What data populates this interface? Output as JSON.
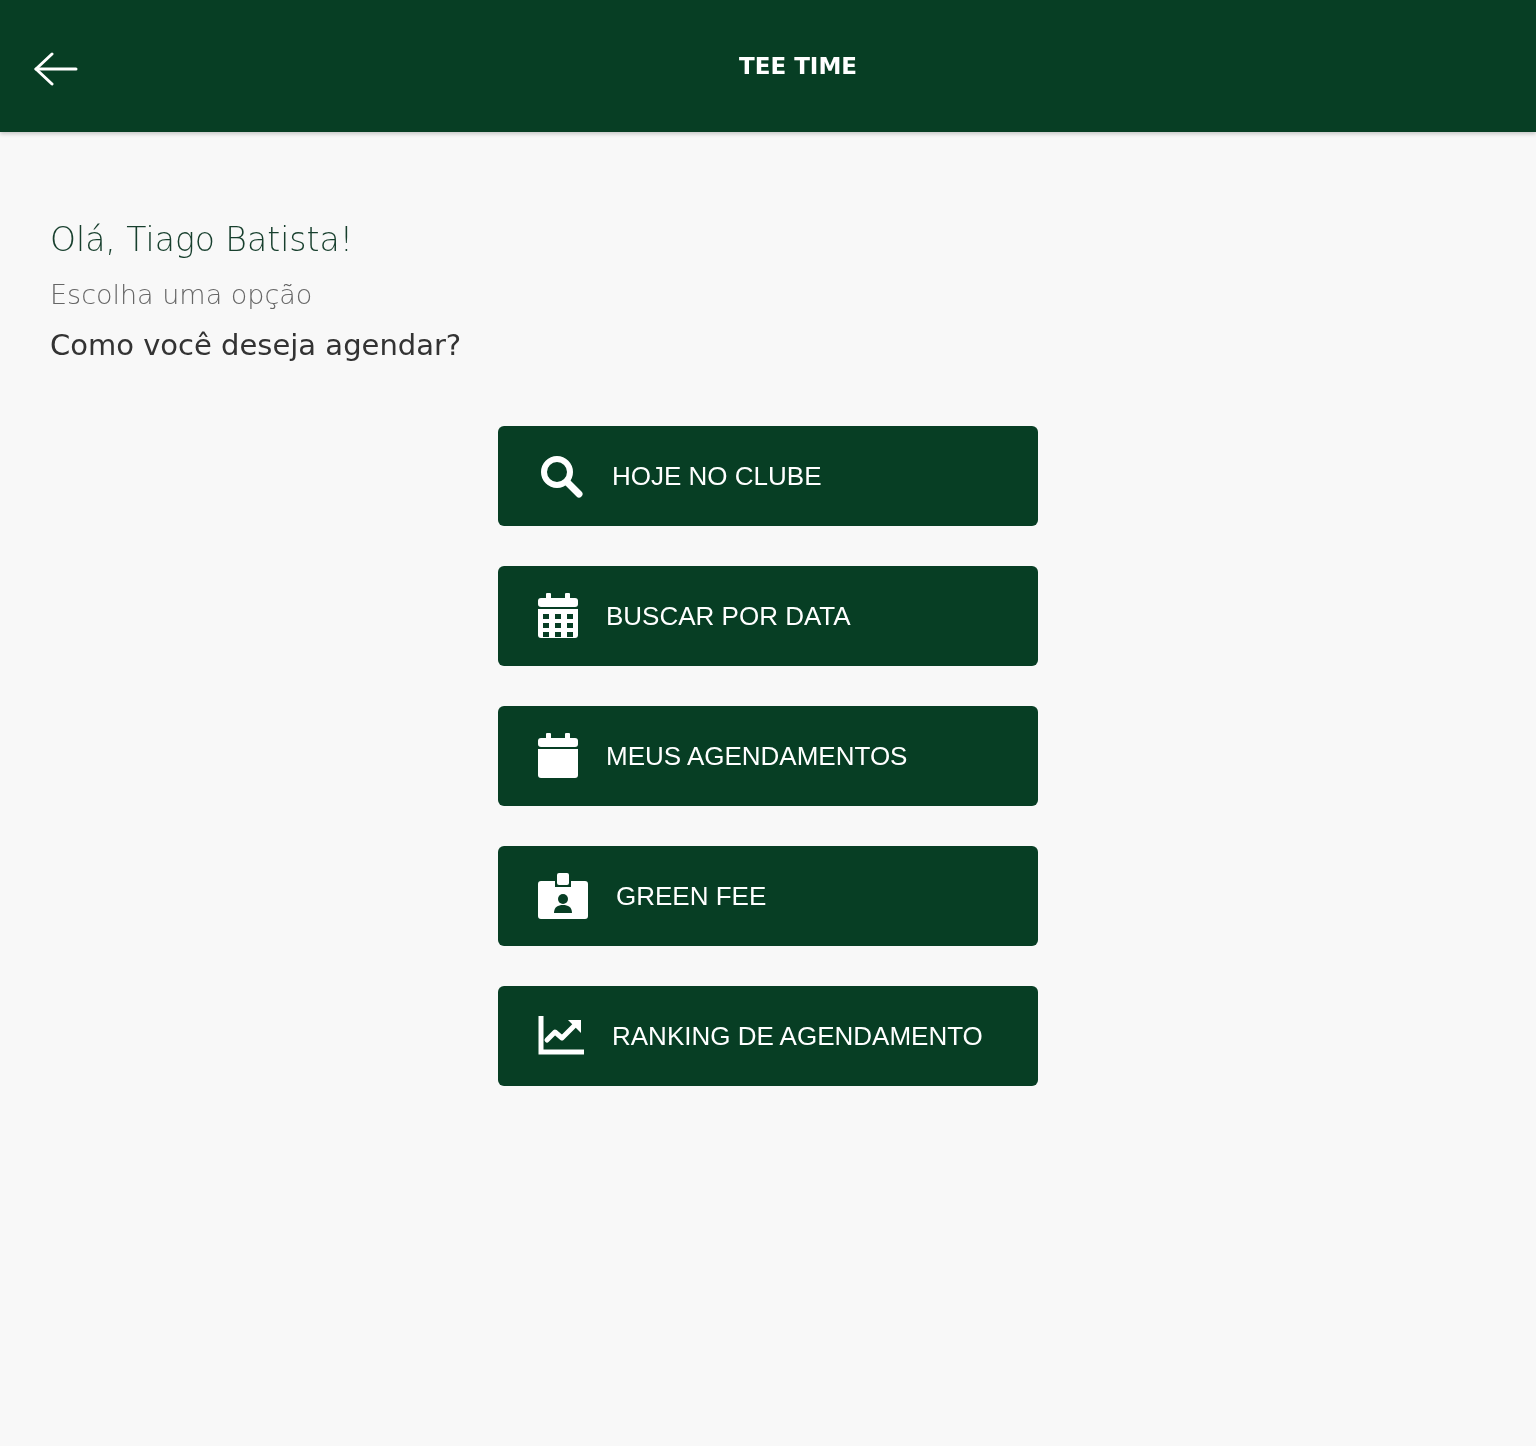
{
  "header": {
    "title": "TEE TIME"
  },
  "greeting": "Olá, Tiago Batista!",
  "subtitle": "Escolha uma opção",
  "question": "Como você deseja agendar?",
  "options": [
    {
      "kind": "search",
      "label": "HOJE NO CLUBE"
    },
    {
      "kind": "calendar-grid",
      "label": "BUSCAR POR DATA"
    },
    {
      "kind": "calendar",
      "label": "MEUS AGENDAMENTOS"
    },
    {
      "kind": "badge",
      "label": "GREEN FEE"
    },
    {
      "kind": "chart",
      "label": "RANKING DE AGENDAMENTO"
    }
  ]
}
